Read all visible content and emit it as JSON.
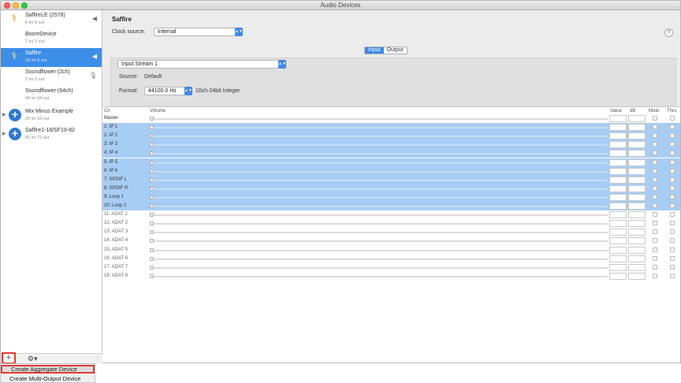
{
  "window": {
    "title": "Audio Devices"
  },
  "sidebar": {
    "devices": [
      {
        "name": "SaffireLE (2578)",
        "io": "6 in/ 8 out",
        "icon": "firewire-icon",
        "right_icon": "speaker-icon"
      },
      {
        "name": "BoomDevice",
        "io": "2 in/ 2 out",
        "icon": "",
        "right_icon": ""
      },
      {
        "name": "Saffire",
        "io": "18 in/ 8 out",
        "icon": "firewire-icon",
        "right_icon": "speaker-icon",
        "selected": true
      },
      {
        "name": "Soundflower (2ch)",
        "io": "2 in/ 2 out",
        "icon": "",
        "right_icon": "microphone-icon"
      },
      {
        "name": "Soundflower (64ch)",
        "io": "64 in/ 64 out",
        "icon": "",
        "right_icon": ""
      },
      {
        "name": "Mix-Minus Example",
        "io": "20 in/ 10 out",
        "icon": "aggregate-icon",
        "right_icon": ""
      },
      {
        "name": "Saffire1-18/SF19-82",
        "io": "82 in/ 72 out",
        "icon": "aggregate-icon",
        "right_icon": ""
      }
    ],
    "add_label": "+",
    "gear_label": "⚙▾"
  },
  "menu": {
    "items": [
      "Create Aggregate Device",
      "Create Multi-Output Device"
    ]
  },
  "main": {
    "device_title": "Saffire",
    "clock_label": "Clock source:",
    "clock_value": "Internal",
    "help_label": "?",
    "tabs": [
      "Input",
      "Output"
    ],
    "stream_value": "Input Stream 1",
    "source_label": "Source:",
    "source_value": "Default",
    "format_label": "Format:",
    "format_value": "44100.0 Hz",
    "format_desc": "10ch-24bit Integer"
  },
  "table": {
    "headers": {
      "ch": "Ch",
      "volume": "Volume",
      "value": "Value",
      "db": "dB",
      "mute": "Mute",
      "thru": "Thru"
    },
    "channels": [
      {
        "label": "Master",
        "selected": false
      },
      {
        "label": "1: IP 1",
        "selected": true
      },
      {
        "label": "2: IP 2",
        "selected": true
      },
      {
        "label": "3: IP 3",
        "selected": true
      },
      {
        "label": "4: IP 4",
        "selected": true
      },
      {
        "label": "5: IP 5",
        "selected": true
      },
      {
        "label": "6: IP 6",
        "selected": true
      },
      {
        "label": "7: SPDIF L",
        "selected": true
      },
      {
        "label": "8: SPDIF R",
        "selected": true
      },
      {
        "label": "9: Loop 1",
        "selected": true
      },
      {
        "label": "10: Loop 2",
        "selected": true
      },
      {
        "label": "11: ADAT 1",
        "selected": false
      },
      {
        "label": "12: ADAT 2",
        "selected": false
      },
      {
        "label": "13: ADAT 3",
        "selected": false
      },
      {
        "label": "14: ADAT 4",
        "selected": false
      },
      {
        "label": "15: ADAT 5",
        "selected": false
      },
      {
        "label": "16: ADAT 6",
        "selected": false
      },
      {
        "label": "17: ADAT 7",
        "selected": false
      },
      {
        "label": "18: ADAT 8",
        "selected": false
      }
    ]
  }
}
